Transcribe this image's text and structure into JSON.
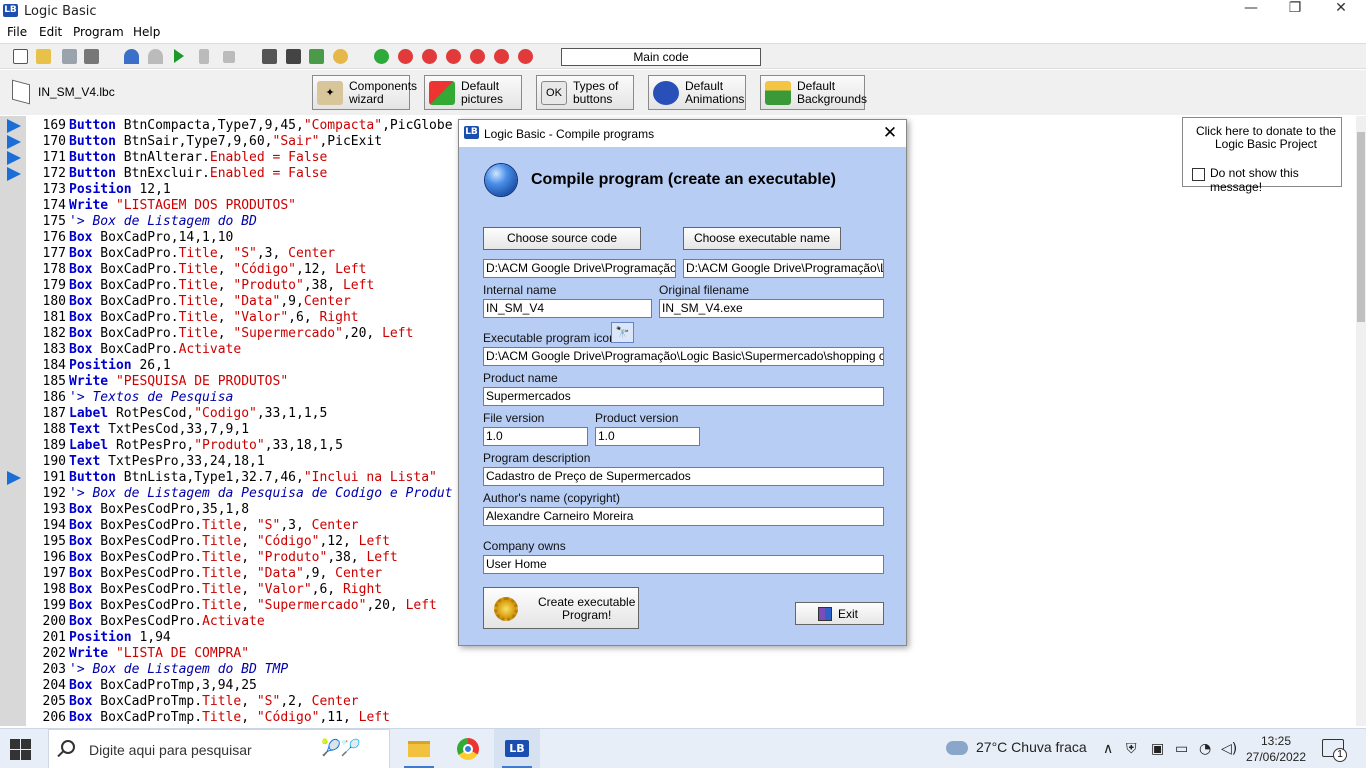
{
  "window": {
    "title": "Logic Basic",
    "app_icon": "LB",
    "minimize": "—",
    "maximize": "❐",
    "close": "✕"
  },
  "menu": [
    "File",
    "Edit",
    "Program",
    "Help"
  ],
  "toolbar": {
    "main_code": "Main code"
  },
  "file": {
    "name": "IN_SM_V4.lbc"
  },
  "top_buttons": [
    {
      "label": "Components\nwizard",
      "icon": "wand-icon"
    },
    {
      "label": "Default\npictures",
      "icon": "puzzle-icon"
    },
    {
      "label": "Types of\nbuttons",
      "icon": "ok-button-icon",
      "icon_text": "OK"
    },
    {
      "label": "Default\nAnimations",
      "icon": "sonic-icon"
    },
    {
      "label": "Default\nBackgrounds",
      "icon": "landscape-icon"
    }
  ],
  "code_lines": [
    {
      "n": "169",
      "bp": true,
      "parts": [
        [
          "k",
          "Button"
        ],
        [
          "t",
          " BtnCompacta,Type7,9,45,"
        ],
        [
          "s",
          "\"Compacta\""
        ],
        [
          "t",
          ",PicGlobe"
        ]
      ]
    },
    {
      "n": "170",
      "bp": true,
      "parts": [
        [
          "k",
          "Button"
        ],
        [
          "t",
          " BtnSair,Type7,9,60,"
        ],
        [
          "s",
          "\"Sair\""
        ],
        [
          "t",
          ",PicExit"
        ]
      ]
    },
    {
      "n": "171",
      "bp": true,
      "parts": [
        [
          "k",
          "Button"
        ],
        [
          "t",
          " BtnAlterar."
        ],
        [
          "s",
          "Enabled"
        ],
        [
          "t",
          " "
        ],
        [
          "s",
          "="
        ],
        [
          "t",
          " "
        ],
        [
          "s",
          "False"
        ]
      ]
    },
    {
      "n": "172",
      "bp": true,
      "parts": [
        [
          "k",
          "Button"
        ],
        [
          "t",
          " BtnExcluir."
        ],
        [
          "s",
          "Enabled"
        ],
        [
          "t",
          " "
        ],
        [
          "s",
          "="
        ],
        [
          "t",
          " "
        ],
        [
          "s",
          "False"
        ]
      ]
    },
    {
      "n": "173",
      "bp": false,
      "parts": [
        [
          "k",
          "Position"
        ],
        [
          "t",
          " 12,1"
        ]
      ]
    },
    {
      "n": "174",
      "bp": false,
      "parts": [
        [
          "k",
          "Write"
        ],
        [
          "t",
          " "
        ],
        [
          "s",
          "\"LISTAGEM DOS PRODUTOS\""
        ]
      ]
    },
    {
      "n": "175",
      "bp": false,
      "parts": [
        [
          "c",
          "'> Box de Listagem do BD"
        ]
      ]
    },
    {
      "n": "176",
      "bp": false,
      "parts": [
        [
          "k",
          "Box"
        ],
        [
          "t",
          " BoxCadPro,14,1,10"
        ]
      ]
    },
    {
      "n": "177",
      "bp": false,
      "parts": [
        [
          "k",
          "Box"
        ],
        [
          "t",
          " BoxCadPro."
        ],
        [
          "s",
          "Title"
        ],
        [
          "t",
          ", "
        ],
        [
          "s",
          "\"S\""
        ],
        [
          "t",
          ",3, "
        ],
        [
          "s",
          "Center"
        ]
      ]
    },
    {
      "n": "178",
      "bp": false,
      "parts": [
        [
          "k",
          "Box"
        ],
        [
          "t",
          " BoxCadPro."
        ],
        [
          "s",
          "Title"
        ],
        [
          "t",
          ", "
        ],
        [
          "s",
          "\"Código\""
        ],
        [
          "t",
          ",12, "
        ],
        [
          "s",
          "Left"
        ]
      ]
    },
    {
      "n": "179",
      "bp": false,
      "parts": [
        [
          "k",
          "Box"
        ],
        [
          "t",
          " BoxCadPro."
        ],
        [
          "s",
          "Title"
        ],
        [
          "t",
          ", "
        ],
        [
          "s",
          "\"Produto\""
        ],
        [
          "t",
          ",38, "
        ],
        [
          "s",
          "Left"
        ]
      ]
    },
    {
      "n": "180",
      "bp": false,
      "parts": [
        [
          "k",
          "Box"
        ],
        [
          "t",
          " BoxCadPro."
        ],
        [
          "s",
          "Title"
        ],
        [
          "t",
          ", "
        ],
        [
          "s",
          "\"Data\""
        ],
        [
          "t",
          ",9,"
        ],
        [
          "s",
          "Center"
        ]
      ]
    },
    {
      "n": "181",
      "bp": false,
      "parts": [
        [
          "k",
          "Box"
        ],
        [
          "t",
          " BoxCadPro."
        ],
        [
          "s",
          "Title"
        ],
        [
          "t",
          ", "
        ],
        [
          "s",
          "\"Valor\""
        ],
        [
          "t",
          ",6, "
        ],
        [
          "s",
          "Right"
        ]
      ]
    },
    {
      "n": "182",
      "bp": false,
      "parts": [
        [
          "k",
          "Box"
        ],
        [
          "t",
          " BoxCadPro."
        ],
        [
          "s",
          "Title"
        ],
        [
          "t",
          ", "
        ],
        [
          "s",
          "\"Supermercado\""
        ],
        [
          "t",
          ",20, "
        ],
        [
          "s",
          "Left"
        ]
      ]
    },
    {
      "n": "183",
      "bp": false,
      "parts": [
        [
          "k",
          "Box"
        ],
        [
          "t",
          " BoxCadPro."
        ],
        [
          "s",
          "Activate"
        ]
      ]
    },
    {
      "n": "184",
      "bp": false,
      "parts": [
        [
          "k",
          "Position"
        ],
        [
          "t",
          " 26,1"
        ]
      ]
    },
    {
      "n": "185",
      "bp": false,
      "parts": [
        [
          "k",
          "Write"
        ],
        [
          "t",
          " "
        ],
        [
          "s",
          "\"PESQUISA DE PRODUTOS\""
        ]
      ]
    },
    {
      "n": "186",
      "bp": false,
      "parts": [
        [
          "c",
          "'> Textos de Pesquisa"
        ]
      ]
    },
    {
      "n": "187",
      "bp": false,
      "parts": [
        [
          "k",
          "Label"
        ],
        [
          "t",
          " RotPesCod,"
        ],
        [
          "s",
          "\"Codigo\""
        ],
        [
          "t",
          ",33,1,1,5"
        ]
      ]
    },
    {
      "n": "188",
      "bp": false,
      "parts": [
        [
          "k",
          "Text"
        ],
        [
          "t",
          " TxtPesCod,33,7,9,1"
        ]
      ]
    },
    {
      "n": "189",
      "bp": false,
      "parts": [
        [
          "k",
          "Label"
        ],
        [
          "t",
          " RotPesPro,"
        ],
        [
          "s",
          "\"Produto\""
        ],
        [
          "t",
          ",33,18,1,5"
        ]
      ]
    },
    {
      "n": "190",
      "bp": false,
      "parts": [
        [
          "k",
          "Text"
        ],
        [
          "t",
          " TxtPesPro,33,24,18,1"
        ]
      ]
    },
    {
      "n": "191",
      "bp": true,
      "parts": [
        [
          "k",
          "Button"
        ],
        [
          "t",
          " BtnLista,Type1,32.7,46,"
        ],
        [
          "s",
          "\"Inclui na Lista\""
        ]
      ]
    },
    {
      "n": "192",
      "bp": false,
      "parts": [
        [
          "c",
          "'> Box de Listagem da Pesquisa de Codigo e Produt"
        ]
      ]
    },
    {
      "n": "193",
      "bp": false,
      "parts": [
        [
          "k",
          "Box"
        ],
        [
          "t",
          " BoxPesCodPro,35,1,8"
        ]
      ]
    },
    {
      "n": "194",
      "bp": false,
      "parts": [
        [
          "k",
          "Box"
        ],
        [
          "t",
          " BoxPesCodPro."
        ],
        [
          "s",
          "Title"
        ],
        [
          "t",
          ", "
        ],
        [
          "s",
          "\"S\""
        ],
        [
          "t",
          ",3, "
        ],
        [
          "s",
          "Center"
        ]
      ]
    },
    {
      "n": "195",
      "bp": false,
      "parts": [
        [
          "k",
          "Box"
        ],
        [
          "t",
          " BoxPesCodPro."
        ],
        [
          "s",
          "Title"
        ],
        [
          "t",
          ", "
        ],
        [
          "s",
          "\"Código\""
        ],
        [
          "t",
          ",12, "
        ],
        [
          "s",
          "Left"
        ]
      ]
    },
    {
      "n": "196",
      "bp": false,
      "parts": [
        [
          "k",
          "Box"
        ],
        [
          "t",
          " BoxPesCodPro."
        ],
        [
          "s",
          "Title"
        ],
        [
          "t",
          ", "
        ],
        [
          "s",
          "\"Produto\""
        ],
        [
          "t",
          ",38, "
        ],
        [
          "s",
          "Left"
        ]
      ]
    },
    {
      "n": "197",
      "bp": false,
      "parts": [
        [
          "k",
          "Box"
        ],
        [
          "t",
          " BoxPesCodPro."
        ],
        [
          "s",
          "Title"
        ],
        [
          "t",
          ", "
        ],
        [
          "s",
          "\"Data\""
        ],
        [
          "t",
          ",9, "
        ],
        [
          "s",
          "Center"
        ]
      ]
    },
    {
      "n": "198",
      "bp": false,
      "parts": [
        [
          "k",
          "Box"
        ],
        [
          "t",
          " BoxPesCodPro."
        ],
        [
          "s",
          "Title"
        ],
        [
          "t",
          ", "
        ],
        [
          "s",
          "\"Valor\""
        ],
        [
          "t",
          ",6, "
        ],
        [
          "s",
          "Right"
        ]
      ]
    },
    {
      "n": "199",
      "bp": false,
      "parts": [
        [
          "k",
          "Box"
        ],
        [
          "t",
          " BoxPesCodPro."
        ],
        [
          "s",
          "Title"
        ],
        [
          "t",
          ", "
        ],
        [
          "s",
          "\"Supermercado\""
        ],
        [
          "t",
          ",20, "
        ],
        [
          "s",
          "Left"
        ]
      ]
    },
    {
      "n": "200",
      "bp": false,
      "parts": [
        [
          "k",
          "Box"
        ],
        [
          "t",
          " BoxPesCodPro."
        ],
        [
          "s",
          "Activate"
        ]
      ]
    },
    {
      "n": "201",
      "bp": false,
      "parts": [
        [
          "k",
          "Position"
        ],
        [
          "t",
          " 1,94"
        ]
      ]
    },
    {
      "n": "202",
      "bp": false,
      "parts": [
        [
          "k",
          "Write"
        ],
        [
          "t",
          " "
        ],
        [
          "s",
          "\"LISTA DE COMPRA\""
        ]
      ]
    },
    {
      "n": "203",
      "bp": false,
      "parts": [
        [
          "c",
          "'> Box de Listagem do BD TMP"
        ]
      ]
    },
    {
      "n": "204",
      "bp": false,
      "parts": [
        [
          "k",
          "Box"
        ],
        [
          "t",
          " BoxCadProTmp,3,94,25"
        ]
      ]
    },
    {
      "n": "205",
      "bp": false,
      "parts": [
        [
          "k",
          "Box"
        ],
        [
          "t",
          " BoxCadProTmp."
        ],
        [
          "s",
          "Title"
        ],
        [
          "t",
          ", "
        ],
        [
          "s",
          "\"S\""
        ],
        [
          "t",
          ",2, "
        ],
        [
          "s",
          "Center"
        ]
      ]
    },
    {
      "n": "206",
      "bp": false,
      "parts": [
        [
          "k",
          "Box"
        ],
        [
          "t",
          " BoxCadProTmp."
        ],
        [
          "s",
          "Title"
        ],
        [
          "t",
          ", "
        ],
        [
          "s",
          "\"Código\""
        ],
        [
          "t",
          ",11, "
        ],
        [
          "s",
          "Left"
        ]
      ]
    }
  ],
  "donate": {
    "message": "Click here to donate to the Logic Basic Project",
    "checkbox_label": "Do not show this message!"
  },
  "dialog": {
    "title": "Logic Basic - Compile programs",
    "heading": "Compile program (create an executable)",
    "choose_source": "Choose source code",
    "choose_exe": "Choose executable name",
    "source_path": "D:\\ACM Google Drive\\Programação\\Lo",
    "exe_path": "D:\\ACM Google Drive\\Programação\\Logi",
    "internal_name_label": "Internal name",
    "internal_name": "IN_SM_V4",
    "original_filename_label": "Original filename",
    "original_filename": "IN_SM_V4.exe",
    "icon_label": "Executable program icon",
    "icon_path": "D:\\ACM Google Drive\\Programação\\Logic Basic\\Supermercado\\shopping cart.ico",
    "product_name_label": "Product name",
    "product_name": "Supermercados",
    "file_version_label": "File version",
    "file_version": "1.0",
    "product_version_label": "Product version",
    "product_version": "1.0",
    "description_label": "Program description",
    "description": "Cadastro de Preço de Supermercados",
    "author_label": "Author's name (copyright)",
    "author": "Alexandre Carneiro Moreira",
    "company_label": "Company owns",
    "company": "User Home",
    "create_btn": "Create executable\nProgram!",
    "exit_btn": "Exit"
  },
  "taskbar": {
    "search_placeholder": "Digite aqui para pesquisar",
    "weather": "27°C  Chuva fraca",
    "time": "13:25",
    "date": "27/06/2022",
    "notifications": "1"
  }
}
